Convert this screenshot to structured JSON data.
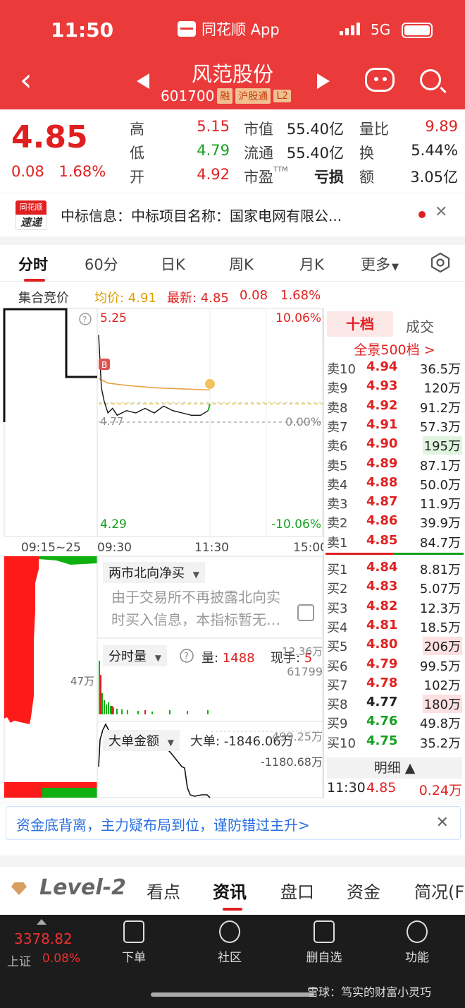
{
  "status_bar": {
    "time": "11:50",
    "app": "同花顺 App",
    "network": "5G"
  },
  "header": {
    "stock_name": "风范股份",
    "code": "601700",
    "tags": [
      "融",
      "沪股通",
      "L2"
    ]
  },
  "quote": {
    "price": "4.85",
    "change": "0.08",
    "change_pct": "1.68%",
    "rows": [
      {
        "k1": "高",
        "v1": "5.15",
        "k2": "市值",
        "v2": "55.40亿",
        "k3": "量比",
        "v3": "9.89"
      },
      {
        "k1": "低",
        "v1": "4.79",
        "k2": "流通",
        "v2": "55.40亿",
        "k3": "换",
        "v3": "5.44%"
      },
      {
        "k1": "开",
        "v1": "4.92",
        "k2": "市盈",
        "k2_sup": "TTM",
        "v2": "亏损",
        "k3": "额",
        "v3": "3.05亿"
      }
    ]
  },
  "news": {
    "badge_top": "同花顺",
    "badge_bottom": "速递",
    "text": "中标信息：中标项目名称：国家电网有限公..."
  },
  "tabs": [
    "分时",
    "60分",
    "日K",
    "周K",
    "月K",
    "更多"
  ],
  "chart_strip": {
    "label": "集合竞价",
    "avg_label": "均价: 4.91",
    "latest_label": "最新: 4.85",
    "chg": "0.08",
    "pct": "1.68%"
  },
  "chart_data": {
    "type": "line",
    "title": "",
    "series": [
      {
        "name": "最新",
        "x": [
          "09:30",
          "09:33",
          "09:36",
          "09:40",
          "09:45",
          "09:50",
          "10:00",
          "10:10",
          "10:20",
          "10:30",
          "10:40",
          "10:50",
          "11:00",
          "11:10",
          "11:20",
          "11:28",
          "11:30"
        ],
        "values": [
          5.15,
          4.92,
          4.86,
          4.81,
          4.83,
          4.8,
          4.82,
          4.81,
          4.83,
          4.81,
          4.84,
          4.82,
          4.81,
          4.8,
          4.8,
          4.82,
          4.85
        ]
      },
      {
        "name": "均价",
        "x": [
          "09:30",
          "09:40",
          "10:00",
          "10:30",
          "11:00",
          "11:30"
        ],
        "values": [
          4.96,
          4.94,
          4.93,
          4.92,
          4.915,
          4.91
        ]
      }
    ],
    "ylim": [
      4.29,
      5.25
    ],
    "y_ticks": [
      "5.25",
      "4.29"
    ],
    "pct_ticks": [
      "10.06%",
      "0.00%",
      "-10.06%"
    ],
    "prev_close": "4.77",
    "x_ticks": [
      "09:15~25",
      "09:30",
      "11:30",
      "15:00"
    ]
  },
  "order_book": {
    "tab_active": "十档",
    "tab_other": "成交",
    "quanjing": "全景500档 >",
    "asks": [
      {
        "l": "卖10",
        "p": "4.94",
        "q": "36.5万"
      },
      {
        "l": "卖9",
        "p": "4.93",
        "q": "120万"
      },
      {
        "l": "卖8",
        "p": "4.92",
        "q": "91.2万"
      },
      {
        "l": "卖7",
        "p": "4.91",
        "q": "57.3万"
      },
      {
        "l": "卖6",
        "p": "4.90",
        "q": "195万"
      },
      {
        "l": "卖5",
        "p": "4.89",
        "q": "87.1万"
      },
      {
        "l": "卖4",
        "p": "4.88",
        "q": "50.0万"
      },
      {
        "l": "卖3",
        "p": "4.87",
        "q": "11.9万"
      },
      {
        "l": "卖2",
        "p": "4.86",
        "q": "39.9万"
      },
      {
        "l": "卖1",
        "p": "4.85",
        "q": "84.7万"
      }
    ],
    "bids": [
      {
        "l": "买1",
        "p": "4.84",
        "q": "8.81万"
      },
      {
        "l": "买2",
        "p": "4.83",
        "q": "5.07万"
      },
      {
        "l": "买3",
        "p": "4.82",
        "q": "12.3万"
      },
      {
        "l": "买4",
        "p": "4.81",
        "q": "18.5万"
      },
      {
        "l": "买5",
        "p": "4.80",
        "q": "206万"
      },
      {
        "l": "买6",
        "p": "4.79",
        "q": "99.5万"
      },
      {
        "l": "买7",
        "p": "4.78",
        "q": "102万"
      },
      {
        "l": "买8",
        "p": "4.77",
        "q": "180万"
      },
      {
        "l": "买9",
        "p": "4.76",
        "q": "49.8万"
      },
      {
        "l": "买10",
        "p": "4.75",
        "q": "35.2万"
      }
    ],
    "mingxi": "明细 ▲",
    "last_trade": {
      "time": "11:30",
      "price": "4.85",
      "vol": "0.24万"
    }
  },
  "indicators": {
    "north_title": "两市北向净买",
    "north_msg_1": "由于交易所不再披露北向实",
    "north_msg_2": "时买入信息，本指标暂无…",
    "vol_title": "分时量",
    "vol_label": "量: ",
    "vol_value": "1488",
    "vol_xianshou_label": "现手: ",
    "vol_xianshou": "5",
    "vol_top": "12.36万",
    "vol_second": "61799",
    "auction_vol": "47万",
    "big_title": "大单金额",
    "big_label": "大单: ",
    "big_value": "-1846.06万",
    "big_top": "-499.25万",
    "big_second": "-1180.68万"
  },
  "promo": {
    "text": "资金底背离，主力疑布局到位，谨防错过主升>"
  },
  "level2": {
    "brand": "Level-2",
    "tabs": [
      "看点",
      "资讯",
      "盘口",
      "资金",
      "简况(F"
    ]
  },
  "bottom_bar": {
    "index_value": "3378.82",
    "index_name": "上证",
    "index_pct": "0.08%",
    "items": [
      "下单",
      "社区",
      "删自选",
      "功能"
    ],
    "watermark": "雪球：笃实的财富小灵巧"
  }
}
